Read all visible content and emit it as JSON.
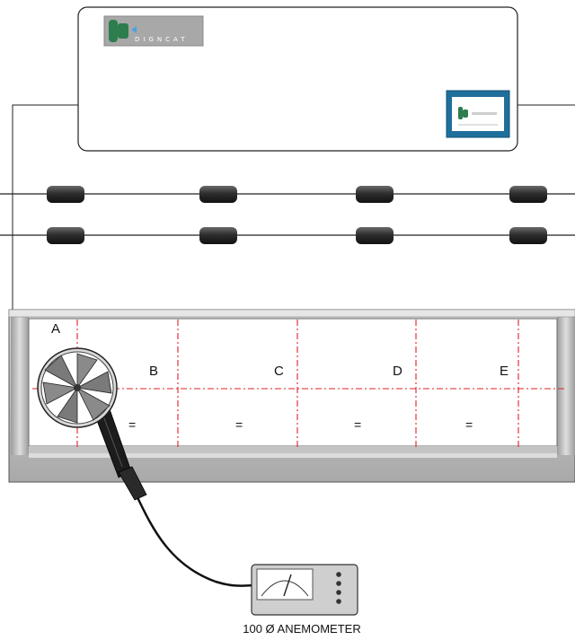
{
  "brand": {
    "name": "DIGNCAT",
    "accent": "#2e7d4f"
  },
  "zones": [
    "A",
    "B",
    "C",
    "D",
    "E"
  ],
  "equal_marks": [
    "=",
    "=",
    "=",
    "="
  ],
  "meter": {
    "caption": "100 Ø ANEMOMETER"
  },
  "colors": {
    "grid_lines": "#e0202a",
    "tray": "#b8b8b8",
    "damper": "#2a2a2a"
  }
}
